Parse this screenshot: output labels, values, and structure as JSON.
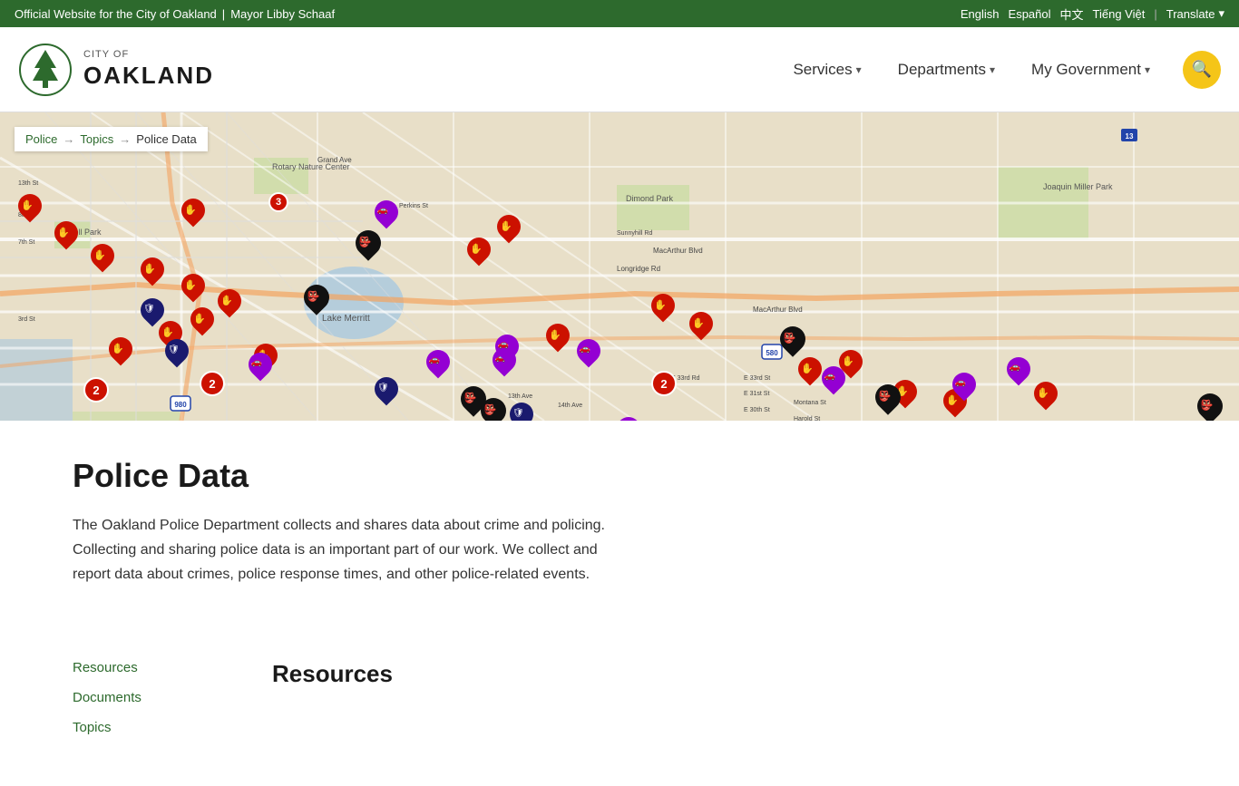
{
  "topbar": {
    "official_text": "Official Website for the City of Oakland",
    "separator": "|",
    "mayor_text": "Mayor Libby Schaaf",
    "languages": [
      "English",
      "Español",
      "中文",
      "Tiếng Việt"
    ],
    "translate_separator": "|",
    "translate_label": "Translate"
  },
  "header": {
    "logo": {
      "city_of": "CITY OF",
      "oakland": "OAKLAND"
    },
    "nav": [
      {
        "label": "Services",
        "has_dropdown": true
      },
      {
        "label": "Departments",
        "has_dropdown": true
      },
      {
        "label": "My Government",
        "has_dropdown": true
      }
    ],
    "search_icon": "🔍"
  },
  "breadcrumb": {
    "items": [
      "Police",
      "Topics",
      "Police Data"
    ]
  },
  "page": {
    "title": "Police Data",
    "description": "The Oakland Police Department collects and shares data about crime and policing. Collecting and sharing police data is an important part of our work. We collect and report data about crimes, police response times, and other police-related events."
  },
  "sidebar": {
    "links": [
      "Resources",
      "Documents",
      "Topics"
    ]
  },
  "resources_section": {
    "title": "Resources"
  },
  "colors": {
    "green_dark": "#2d6a2d",
    "green_header": "#2e7d32",
    "yellow": "#f5c518",
    "black": "#1a1a1a"
  }
}
